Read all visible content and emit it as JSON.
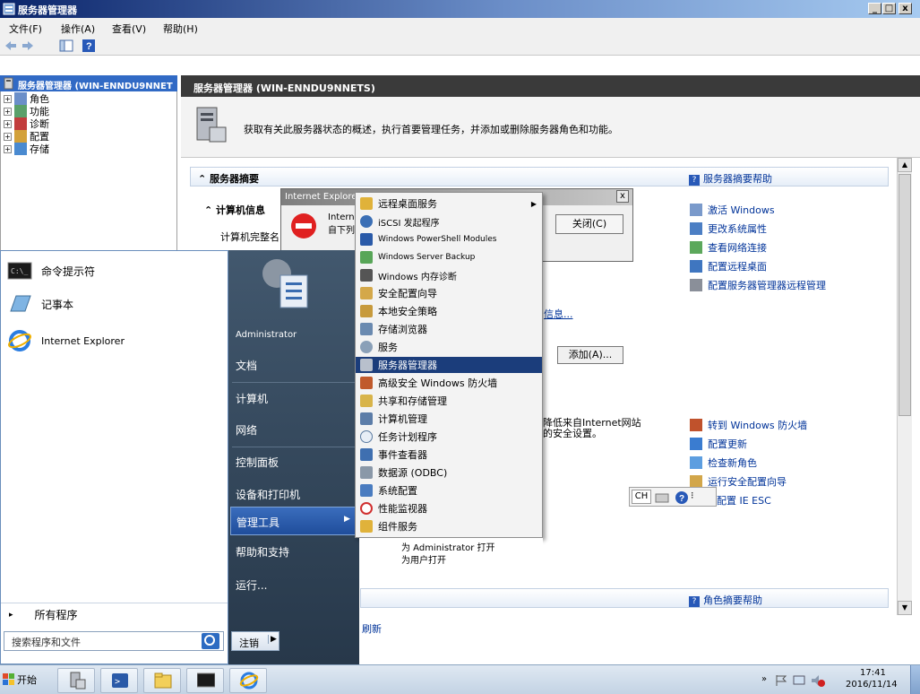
{
  "window": {
    "title": "服务器管理器",
    "min": "_",
    "restore": "□",
    "close": "x"
  },
  "menu": {
    "file": "文件(F)",
    "action": "操作(A)",
    "view": "查看(V)",
    "help": "帮助(H)"
  },
  "tree": {
    "root": "服务器管理器 (WIN-ENNDU9NNET",
    "items": [
      "角色",
      "功能",
      "诊断",
      "配置",
      "存储"
    ]
  },
  "content": {
    "header": "服务器管理器 (WIN-ENNDU9NNETS)",
    "intro": "获取有关此服务器状态的概述，执行首要管理任务，并添加或删除服务器角色和功能。",
    "summary_title": "服务器摘要",
    "summary_help": "服务器摘要帮助",
    "computer_info": "计算机信息",
    "computer_full": "计算机完整名",
    "close_btn": "关闭(C)",
    "info_link": "信息...",
    "add_btn": "添加(A)...",
    "ie_note": "降低来自Internet网站的安全设置。",
    "open_admin": "为 Administrator 打开",
    "open_users": "为用户打开",
    "refresh": "刷新",
    "roles_help": "角色摘要帮助",
    "links_top": [
      "激活 Windows",
      "更改系统属性",
      "查看网络连接",
      "配置远程桌面",
      "配置服务器管理器远程管理"
    ],
    "links_bottom": [
      "转到 Windows 防火墙",
      "配置更新",
      "检查新角色",
      "运行安全配置向导",
      "配置 IE ESC"
    ],
    "lang": "CH"
  },
  "dialog": {
    "title": "Internet Explorer",
    "line1": "Internet",
    "line2": "自下列"
  },
  "start_menu": {
    "pinned": [
      "命令提示符",
      "记事本",
      "Internet Explorer"
    ],
    "all_programs": "所有程序",
    "search_placeholder": "搜索程序和文件",
    "right": [
      "Administrator",
      "文档",
      "计算机",
      "网络",
      "控制面板",
      "设备和打印机",
      "管理工具",
      "帮助和支持",
      "运行..."
    ],
    "logoff": "注销"
  },
  "submenu": {
    "items": [
      "远程桌面服务",
      "iSCSI 发起程序",
      "Windows PowerShell Modules",
      "Windows Server Backup",
      "Windows 内存诊断",
      "安全配置向导",
      "本地安全策略",
      "存储浏览器",
      "服务",
      "服务器管理器",
      "高级安全 Windows 防火墙",
      "共享和存储管理",
      "计算机管理",
      "任务计划程序",
      "事件查看器",
      "数据源 (ODBC)",
      "系统配置",
      "性能监视器",
      "组件服务"
    ],
    "highlight_index": 9
  },
  "taskbar": {
    "start": "开始",
    "time": "17:41",
    "date": "2016/11/14"
  },
  "colors": {
    "highlight": "#1b3d7b",
    "title_blue": "#0a246a",
    "start_panel": "#2d3f52"
  }
}
